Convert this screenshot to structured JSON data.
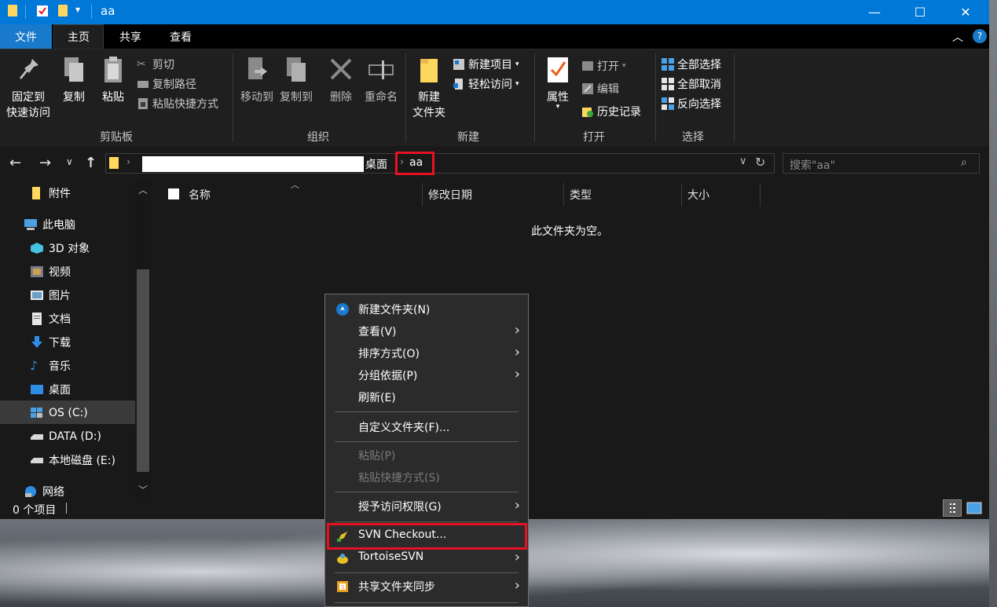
{
  "window": {
    "title": "aa"
  },
  "ribbon": {
    "tabs": {
      "file": "文件",
      "home": "主页",
      "share": "共享",
      "view": "查看"
    },
    "clipboard": {
      "group_label": "剪贴板",
      "pin_line1": "固定到",
      "pin_line2": "快速访问",
      "copy": "复制",
      "paste": "粘贴",
      "cut": "剪切",
      "copy_path": "复制路径",
      "paste_shortcut": "粘贴快捷方式"
    },
    "organize": {
      "group_label": "组织",
      "move_to": "移动到",
      "copy_to": "复制到",
      "delete": "删除",
      "rename": "重命名"
    },
    "new": {
      "group_label": "新建",
      "new_folder_line1": "新建",
      "new_folder_line2": "文件夹",
      "new_item": "新建项目",
      "easy_access": "轻松访问"
    },
    "open": {
      "group_label": "打开",
      "properties": "属性",
      "open": "打开",
      "edit": "编辑",
      "history": "历史记录"
    },
    "select": {
      "group_label": "选择",
      "select_all": "全部选择",
      "select_none": "全部取消",
      "invert": "反向选择"
    }
  },
  "address": {
    "crumb_desktop": "桌面",
    "crumb_current": "aa",
    "search_placeholder": "搜索\"aa\""
  },
  "nav": {
    "items": [
      {
        "label": "附件"
      },
      {
        "label": "此电脑"
      },
      {
        "label": "3D 对象"
      },
      {
        "label": "视频"
      },
      {
        "label": "图片"
      },
      {
        "label": "文档"
      },
      {
        "label": "下载"
      },
      {
        "label": "音乐"
      },
      {
        "label": "桌面"
      },
      {
        "label": "OS (C:)"
      },
      {
        "label": "DATA (D:)"
      },
      {
        "label": "本地磁盘 (E:)"
      },
      {
        "label": "网络"
      }
    ]
  },
  "content": {
    "columns": [
      "名称",
      "修改日期",
      "类型",
      "大小"
    ],
    "empty_message": "此文件夹为空。"
  },
  "status": {
    "item_count": "0 个项目"
  },
  "context_menu": {
    "items": [
      {
        "label": "新建文件夹(N)"
      },
      {
        "label": "查看(V)"
      },
      {
        "label": "排序方式(O)"
      },
      {
        "label": "分组依据(P)"
      },
      {
        "label": "刷新(E)"
      },
      {
        "label": "自定义文件夹(F)..."
      },
      {
        "label": "粘贴(P)"
      },
      {
        "label": "粘贴快捷方式(S)"
      },
      {
        "label": "授予访问权限(G)"
      },
      {
        "label": "SVN Checkout..."
      },
      {
        "label": "TortoiseSVN"
      },
      {
        "label": "共享文件夹同步"
      }
    ]
  },
  "colors": {
    "accent": "#0078d7",
    "highlight_red": "#e81123",
    "folder_yellow": "#ffd75e"
  }
}
